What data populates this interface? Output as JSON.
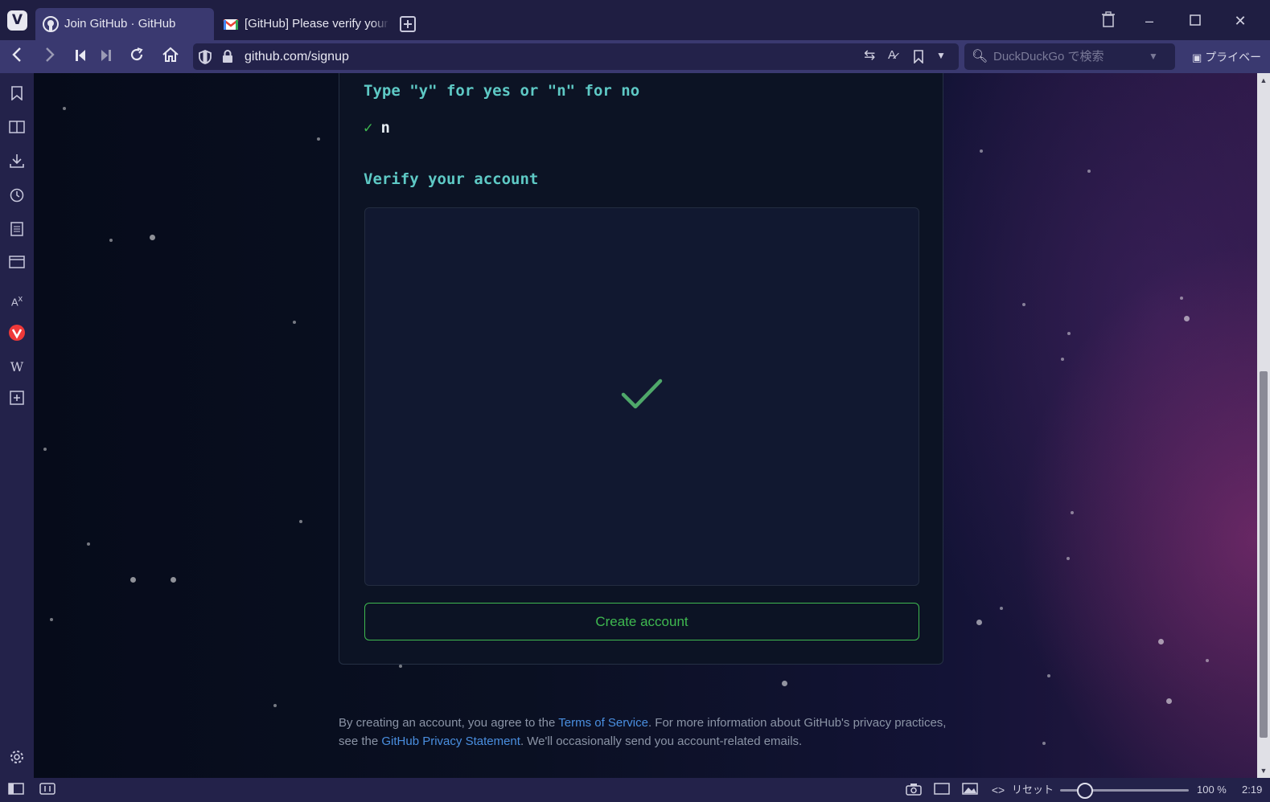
{
  "browser": {
    "tabs": [
      {
        "label": "Join GitHub · GitHub",
        "active": true
      },
      {
        "label": "[GitHub] Please verify your email",
        "active": false
      }
    ],
    "url": "github.com/signup",
    "search_placeholder": "DuckDuckGo で検索",
    "private_label": "プライベート"
  },
  "status_bar": {
    "reset_label": "リセット",
    "zoom": "100 %",
    "time": "2:19",
    "zoom_slider_value": 0.13
  },
  "signup": {
    "prompt": "Type \"y\" for yes or \"n\" for no",
    "answer": "n",
    "verify_title": "Verify your account",
    "create_button": "Create account"
  },
  "terms": {
    "part1": "By creating an account, you agree to the ",
    "tos_link": "Terms of Service",
    "part2": ". For more information about GitHub's privacy practices, see the ",
    "privacy_link": "GitHub Privacy Statement",
    "part3": ". We'll occasionally send you account-related emails."
  },
  "colors": {
    "accent_green": "#3fb950",
    "heading_teal": "#5ec9c5",
    "link_blue": "#4a8fe0",
    "browser_chrome": "#3a3970"
  }
}
